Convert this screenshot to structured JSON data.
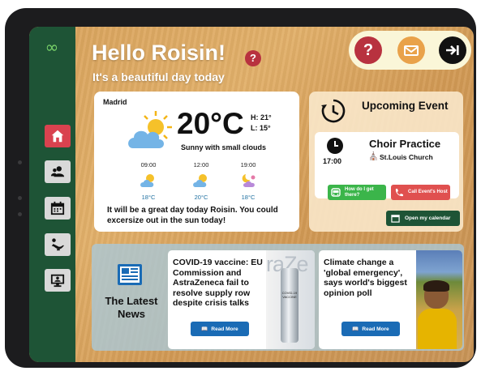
{
  "greeting": {
    "title": "Hello Roisin!",
    "subtitle": "It's a beautiful day today",
    "help_label": "?"
  },
  "sidebar": {
    "logo_glyph": "∞",
    "items": [
      {
        "name": "home",
        "icon": "home-icon",
        "active": true
      },
      {
        "name": "contacts",
        "icon": "people-icon",
        "active": false
      },
      {
        "name": "calendar",
        "icon": "calendar-icon",
        "active": false
      },
      {
        "name": "genie",
        "icon": "magic-lamp-icon",
        "active": false
      },
      {
        "name": "video-call",
        "icon": "computer-call-icon",
        "active": false
      }
    ]
  },
  "topbar": {
    "help": {
      "label": "?",
      "icon": "question-icon",
      "color": "#b8323f"
    },
    "mail": {
      "icon": "mail-icon",
      "color": "#e9a24a"
    },
    "logout": {
      "icon": "logout-icon",
      "color": "#111111"
    }
  },
  "weather": {
    "city": "Madrid",
    "temperature": "20°C",
    "high": "H: 21°",
    "low": "L: 15°",
    "description": "Sunny with small clouds",
    "icon": "sun-cloud-icon",
    "hourly": [
      {
        "time": "09:00",
        "temp": "18°C",
        "icon": "sun-cloud-icon"
      },
      {
        "time": "12:00",
        "temp": "20°C",
        "icon": "sun-cloud-icon"
      },
      {
        "time": "19:00",
        "temp": "18°C",
        "icon": "moon-cloud-icon"
      }
    ],
    "message": "It will be a great day today Roisin. You could excersize out in the sun today!"
  },
  "event": {
    "header": "Upcoming Event",
    "time": "17:00",
    "name": "Choir Practice",
    "place": "St.Louis Church",
    "directions_label": "How do I get there?",
    "call_label": "Call Event's Host",
    "calendar_label": "Open my calendar",
    "colors": {
      "directions": "#3bb54a",
      "call": "#e0504f",
      "calendar": "#1e5436"
    }
  },
  "news": {
    "title": "The Latest News",
    "articles": [
      {
        "headline": "COVID-19 vaccine: EU Commission and AstraZeneca fail to resolve supply row despite crisis talks",
        "button": "Read More",
        "image_text": "raZe",
        "vial_label": "COVID-19 VACCINE"
      },
      {
        "headline": "Climate change a 'global emergency', says world's biggest opinion poll",
        "button": "Read More"
      }
    ]
  },
  "colors": {
    "sidebar": "#1e5436",
    "active_nav": "#d9424f",
    "accent_blue": "#1a6bb5"
  }
}
